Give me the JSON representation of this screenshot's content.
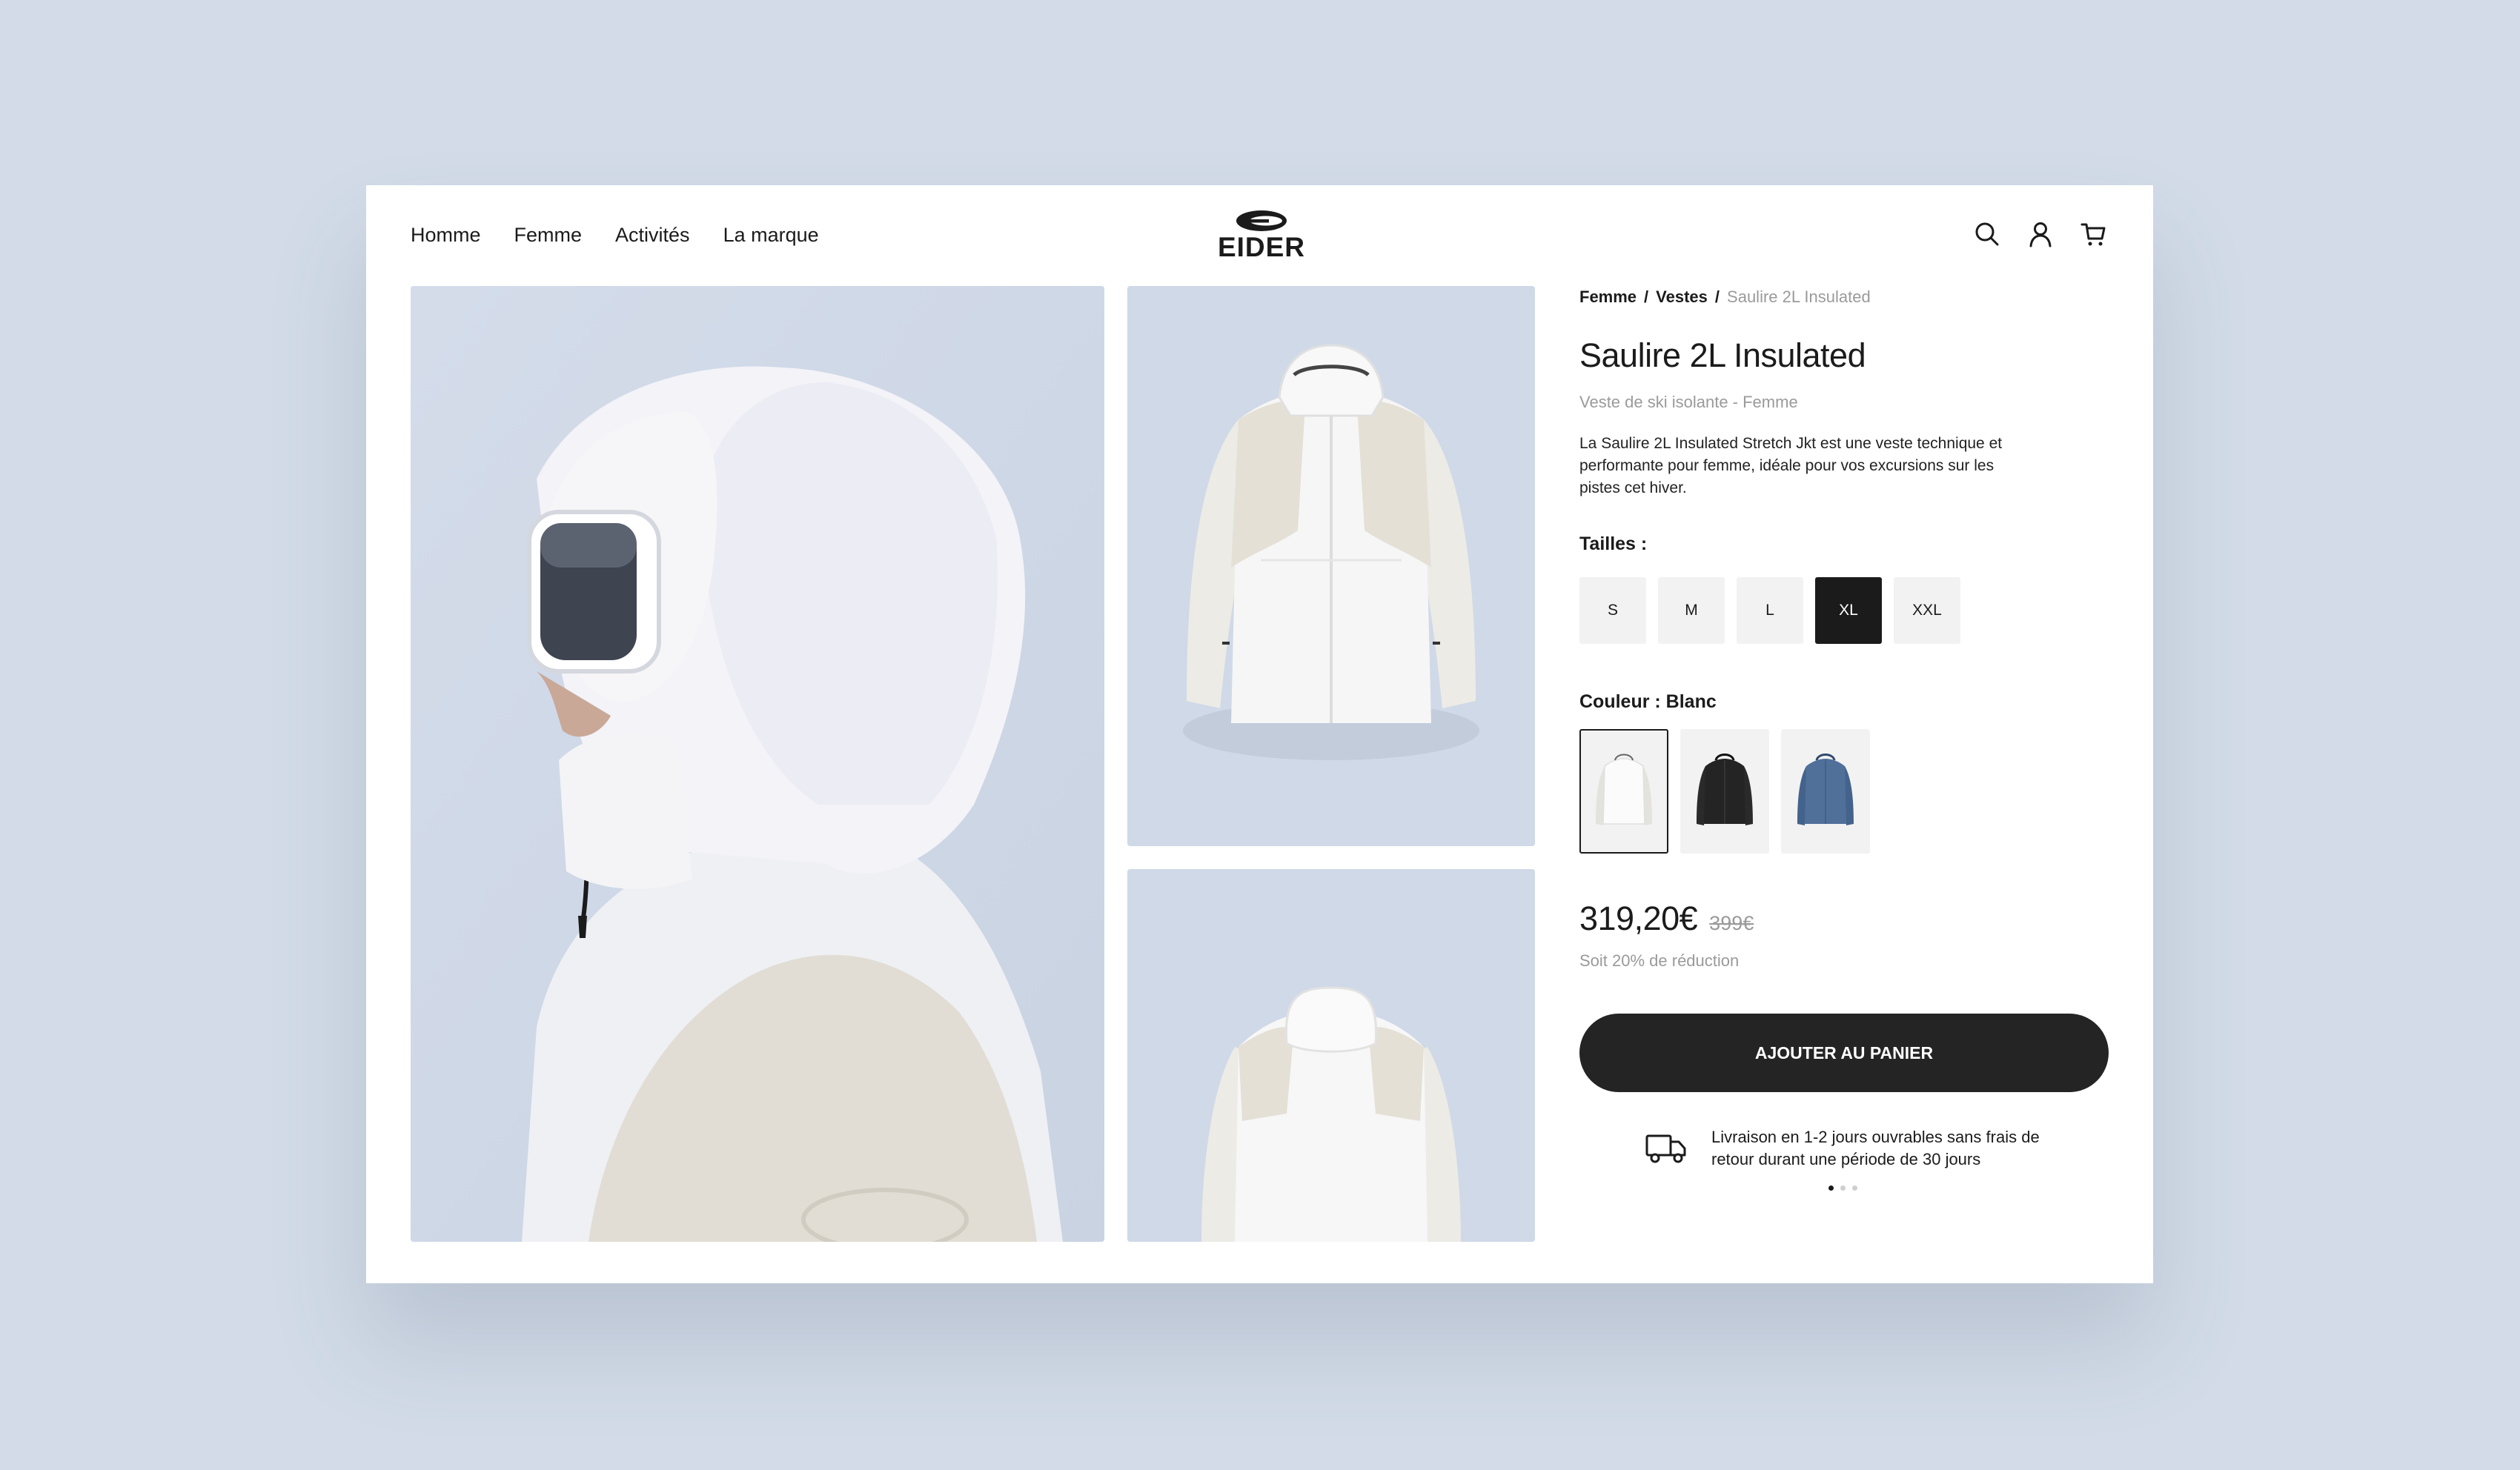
{
  "nav": {
    "items": [
      "Homme",
      "Femme",
      "Activités",
      "La marque"
    ]
  },
  "brand": {
    "logo_text": "EIDER"
  },
  "icons": {
    "search": "search-icon",
    "account": "user-icon",
    "cart": "cart-icon",
    "delivery": "truck-icon"
  },
  "breadcrumb": {
    "items": [
      "Femme",
      "Vestes"
    ],
    "current": "Saulire 2L Insulated",
    "separator": "/"
  },
  "product": {
    "title": "Saulire 2L Insulated",
    "subtitle": "Veste de ski isolante - Femme",
    "description": "La Saulire 2L Insulated Stretch Jkt est une veste technique et performante pour femme, idéale pour vos excursions sur les pistes cet hiver.",
    "sizes_label": "Tailles :",
    "sizes": [
      "S",
      "M",
      "L",
      "XL",
      "XXL"
    ],
    "selected_size": "XL",
    "color_label": "Couleur : Blanc",
    "colors": [
      {
        "name": "Blanc",
        "hex": "#f4f4f2"
      },
      {
        "name": "Noir",
        "hex": "#242424"
      },
      {
        "name": "Bleu",
        "hex": "#50709a"
      }
    ],
    "selected_color": "Blanc",
    "price": "319,20€",
    "old_price": "399€",
    "discount_text": "Soit 20% de réduction",
    "cta": "AJOUTER AU PANIER",
    "delivery_text": "Livraison en 1-2 jours ouvrables sans frais de retour durant une période de 30 jours"
  },
  "carousel": {
    "count": 3,
    "active": 0
  },
  "colors": {
    "background": "#d2dbe7",
    "photo_bg": "#d0d9e7",
    "dark": "#1b1b1b",
    "muted": "#9a9a9a",
    "chip": "#f2f2f2"
  }
}
